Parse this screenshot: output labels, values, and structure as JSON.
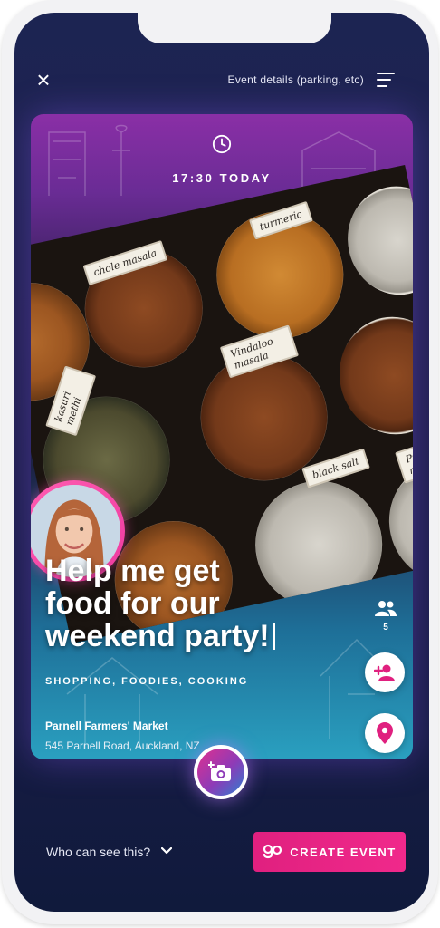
{
  "header": {
    "close_icon": "close-icon",
    "details_link": "Event details (parking, etc)",
    "menu_icon": "menu-icon"
  },
  "event": {
    "time": "17:30 TODAY",
    "title_line1": "Help me get",
    "title_line2": "food for our",
    "title_line3": "weekend party!",
    "tags": "SHOPPING, FOODIES, COOKING",
    "venue_name": "Parnell Farmers' Market",
    "venue_address": "545 Parnell Road, Auckland, NZ",
    "attendee_count": "5"
  },
  "photo_labels": {
    "l1": "chole masala",
    "l2": "turmeric",
    "l3": "Vindaloo masala",
    "l4": "kasuri methi",
    "l5": "black salt",
    "l6": "Puffed rice"
  },
  "footer": {
    "visibility_label": "Who can see this?",
    "create_label": "CREATE EVENT"
  },
  "colors": {
    "accent": "#e0207f",
    "background": "#1c2452"
  }
}
